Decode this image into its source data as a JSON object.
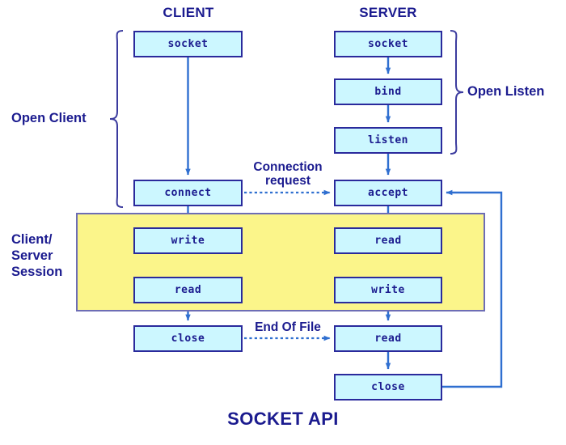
{
  "diagram": {
    "title": "SOCKET API",
    "columns": [
      {
        "name": "client",
        "label": "CLIENT"
      },
      {
        "name": "server",
        "label": "SERVER"
      }
    ],
    "colors": {
      "box_fill": "#ccf7ff",
      "box_border": "#2a2a9c",
      "session_fill": "#fbf58a",
      "session_border": "#6d6db5",
      "text": "#1b1b8f",
      "arrow": "#2f6fd0",
      "background": "#ffffff"
    },
    "client_boxes": [
      {
        "name": "client-socket",
        "label": "socket"
      },
      {
        "name": "client-connect",
        "label": "connect"
      },
      {
        "name": "client-write",
        "label": "write"
      },
      {
        "name": "client-read",
        "label": "read"
      },
      {
        "name": "client-close",
        "label": "close"
      }
    ],
    "server_boxes": [
      {
        "name": "server-socket",
        "label": "socket"
      },
      {
        "name": "server-bind",
        "label": "bind"
      },
      {
        "name": "server-listen",
        "label": "listen"
      },
      {
        "name": "server-accept",
        "label": "accept"
      },
      {
        "name": "server-read-session",
        "label": "read"
      },
      {
        "name": "server-write-session",
        "label": "write"
      },
      {
        "name": "server-read-eof",
        "label": "read"
      },
      {
        "name": "server-close",
        "label": "close"
      }
    ],
    "brace_labels": [
      {
        "name": "open-client",
        "label": "Open Client"
      },
      {
        "name": "open-listen",
        "label": "Open Listen"
      }
    ],
    "session_label": "Client/\nServer\nSession",
    "edge_labels": [
      {
        "name": "connection-request",
        "label": "Connection\nrequest"
      },
      {
        "name": "end-of-file",
        "label": "End Of File"
      }
    ]
  }
}
